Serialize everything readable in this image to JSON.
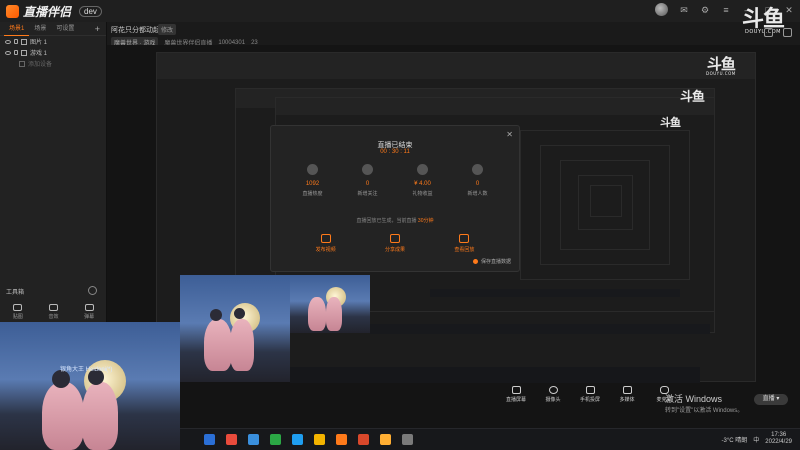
{
  "app": {
    "logo_text": "直播伴侣",
    "version_badge": "dev",
    "watermark_big": "斗鱼",
    "watermark_small": "DOUYU.COM"
  },
  "left_panel": {
    "tabs": [
      "场景1",
      "场景",
      "可设置"
    ],
    "layers": [
      {
        "label": "图片 1"
      },
      {
        "label": "游戏 1"
      },
      {
        "label": "添加设备"
      }
    ],
    "toolbox_title": "工具箱",
    "tools": [
      {
        "label": "贴图"
      },
      {
        "label": "音效"
      },
      {
        "label": "弹幕"
      }
    ]
  },
  "header": {
    "room_title": "阿花只分都动起",
    "room_tag": "修改",
    "category": "魔兽世界 · 游戏",
    "room_subcat": "魔兽世界伴侣直播",
    "room_id": "10004301",
    "viewers": "23"
  },
  "modal": {
    "title": "直播已结束",
    "time": "00 : 30 : 11",
    "stats": [
      {
        "value": "1092",
        "label": "直播热度"
      },
      {
        "value": "0",
        "label": "新增关注"
      },
      {
        "value": "¥ 4.00",
        "label": "礼物收益"
      },
      {
        "value": "0",
        "label": "新增人数"
      }
    ],
    "note_prefix": "直播回放已生成，当前直播",
    "note_highlight": "30分钟",
    "actions": [
      {
        "label": "发布视频"
      },
      {
        "label": "分享成果"
      },
      {
        "label": "查看回放"
      }
    ],
    "save_checkbox": "保存直播数据"
  },
  "game": {
    "player_name": "银角大王 Heideni(*)"
  },
  "controls": [
    {
      "label": "直播屏幕"
    },
    {
      "label": "摄像头"
    },
    {
      "label": "手机投屏"
    },
    {
      "label": "多媒体"
    },
    {
      "label": "麦克风"
    }
  ],
  "start_button": "直播 ▾",
  "activation": {
    "line1": "激活 Windows",
    "line2": "转到\"设置\"以激活 Windows。"
  },
  "taskbar": {
    "weather": "-3°C 晴朗",
    "time": "17:36",
    "date": "2022/4/29",
    "lang": "中",
    "icon_colors": [
      "#2b6fd6",
      "#e94b3c",
      "#3a8fdd",
      "#2ba845",
      "#1f9ef0",
      "#f4b400",
      "#ff7a1a",
      "#d9482b",
      "#ffae33",
      "#7a7a7a"
    ]
  },
  "colors": {
    "accent": "#ff7a1a"
  }
}
